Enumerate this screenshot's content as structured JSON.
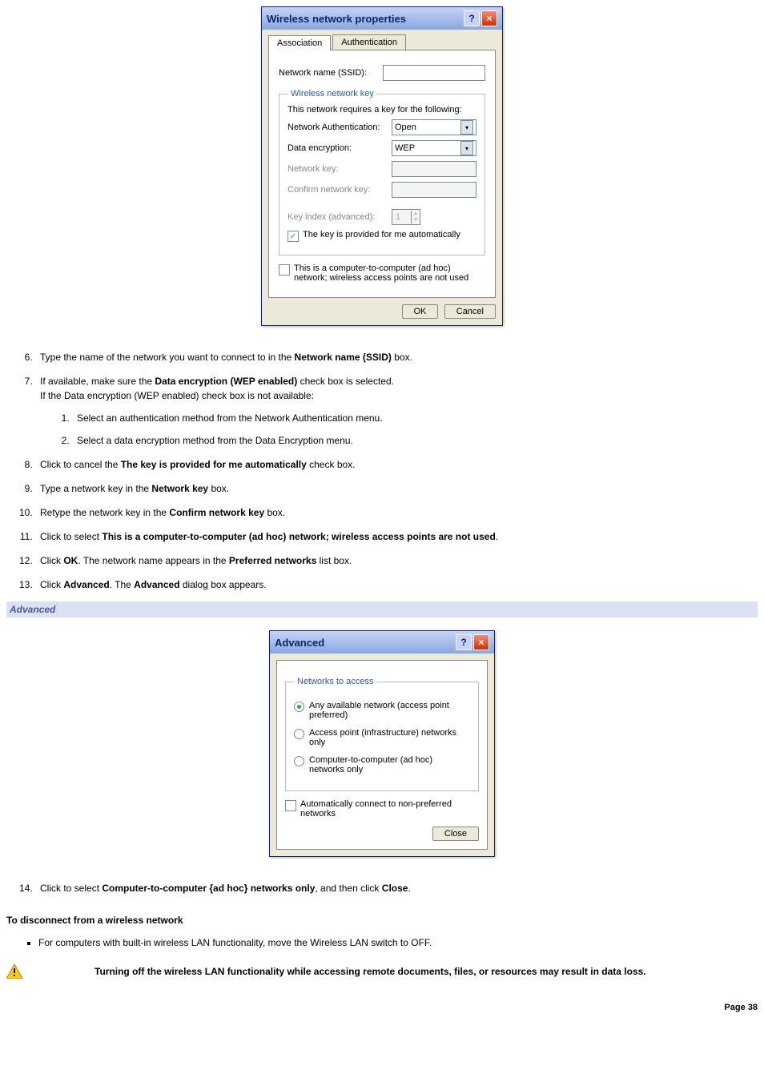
{
  "dialog1": {
    "title": "Wireless network properties",
    "tabs": [
      "Association",
      "Authentication"
    ],
    "ssid_label": "Network name (SSID):",
    "ssid_value": "",
    "fieldset_legend": "Wireless network key",
    "fs_intro": "This network requires a key for the following:",
    "auth_label": "Network Authentication:",
    "auth_value": "Open",
    "enc_label": "Data encryption:",
    "enc_value": "WEP",
    "netkey_label": "Network key:",
    "confirmkey_label": "Confirm network key:",
    "keyindex_label": "Key index (advanced):",
    "keyindex_value": "1",
    "chk_auto_label": "The key is provided for me automatically",
    "chk_auto_checked": true,
    "chk_adhoc_label": "This is a computer-to-computer (ad hoc) network; wireless access points are not used",
    "chk_adhoc_checked": false,
    "btn_ok": "OK",
    "btn_cancel": "Cancel"
  },
  "dialog2": {
    "title": "Advanced",
    "fieldset_legend": "Networks to access",
    "radios": [
      {
        "label": "Any available network (access point preferred)",
        "checked": true
      },
      {
        "label": "Access point (infrastructure) networks only",
        "checked": false
      },
      {
        "label": "Computer-to-computer (ad hoc) networks only",
        "checked": false
      }
    ],
    "chk_auto_label": "Automatically connect to non-preferred networks",
    "chk_auto_checked": false,
    "btn_close": "Close"
  },
  "steps": {
    "s6_a": "Type the name of the network you want to connect to in the ",
    "s6_b": "Network name (SSID)",
    "s6_c": " box.",
    "s7_a": "If available, make sure the ",
    "s7_b": "Data encryption (WEP enabled)",
    "s7_c": " check box is selected.",
    "s7_line2": "If the Data encryption (WEP enabled) check box is not available:",
    "s7_sub1": "Select an authentication method from the Network Authentication menu.",
    "s7_sub2": "Select a data encryption method from the Data Encryption menu.",
    "s8_a": "Click to cancel the ",
    "s8_b": "The key is provided for me automatically",
    "s8_c": " check box.",
    "s9_a": "Type a network key in the ",
    "s9_b": "Network key",
    "s9_c": " box.",
    "s10_a": "Retype the network key in the ",
    "s10_b": "Confirm network key",
    "s10_c": " box.",
    "s11_a": "Click to select ",
    "s11_b": "This is a computer-to-computer (ad hoc) network; wireless access points are not used",
    "s11_c": ".",
    "s12_a": "Click ",
    "s12_b": "OK",
    "s12_c": ". The network name appears in the ",
    "s12_d": "Preferred networks",
    "s12_e": " list box.",
    "s13_a": "Click ",
    "s13_b": "Advanced",
    "s13_c": ". The ",
    "s13_d": "Advanced",
    "s13_e": " dialog box appears.",
    "s14_a": "Click to select ",
    "s14_b": "Computer-to-computer {ad hoc} networks only",
    "s14_c": ", and then click ",
    "s14_d": "Close",
    "s14_e": "."
  },
  "banner_advanced": "Advanced",
  "heading_disconnect": "To disconnect from a wireless network",
  "bullet_disconnect": "For computers with built-in wireless LAN functionality, move the Wireless LAN switch to OFF.",
  "warning_text": "Turning off the wireless LAN functionality while accessing remote documents, files, or resources may result in data loss.",
  "page_footer": "Page 38"
}
